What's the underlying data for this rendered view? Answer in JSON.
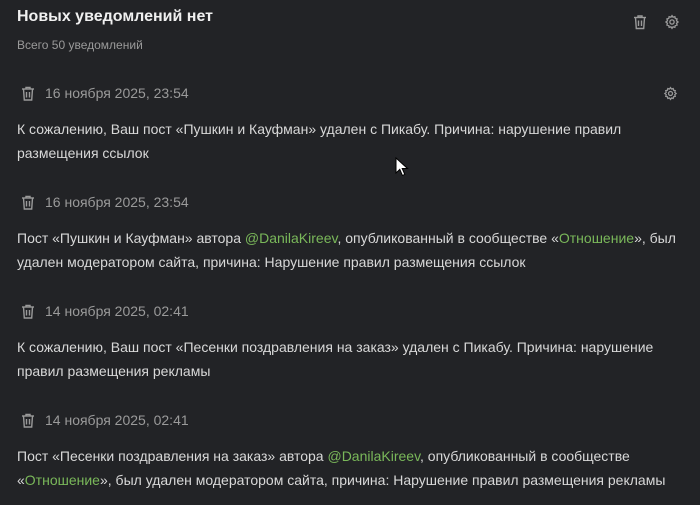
{
  "header": {
    "title": "Новых уведомлений нет",
    "subtitle": "Всего 50 уведомлений"
  },
  "icons": {
    "trash": "trash-icon",
    "settings": "gear-icon"
  },
  "colors": {
    "background": "#222326",
    "link": "#7ab85a"
  },
  "notifications": [
    {
      "date": "16 ноября 2025, 23:54",
      "text_before": "К сожалению, Ваш пост «Пушкин и Кауфман» удален с Пикабу. Причина: нарушение правил размещения ссылок"
    },
    {
      "date": "16 ноября 2025, 23:54",
      "text_1": "Пост «Пушкин и Кауфман» автора ",
      "author": "@DanilaKireev",
      "text_2": ", опубликованный в сообществе «",
      "community": "Отношение",
      "text_3": "», был удален модератором сайта, причина: Нарушение правил размещения ссылок"
    },
    {
      "date": "14 ноября 2025, 02:41",
      "text_before": "К сожалению, Ваш пост «Песенки поздравления на заказ» удален с Пикабу. Причина: нарушение правил размещения рекламы"
    },
    {
      "date": "14 ноября 2025, 02:41",
      "text_1": "Пост «Песенки поздравления на заказ» автора ",
      "author": "@DanilaKireev",
      "text_2": ", опубликованный в сообществе «",
      "community": "Отношение",
      "text_3": "», был удален модератором сайта, причина: Нарушение правил размещения рекламы"
    }
  ]
}
